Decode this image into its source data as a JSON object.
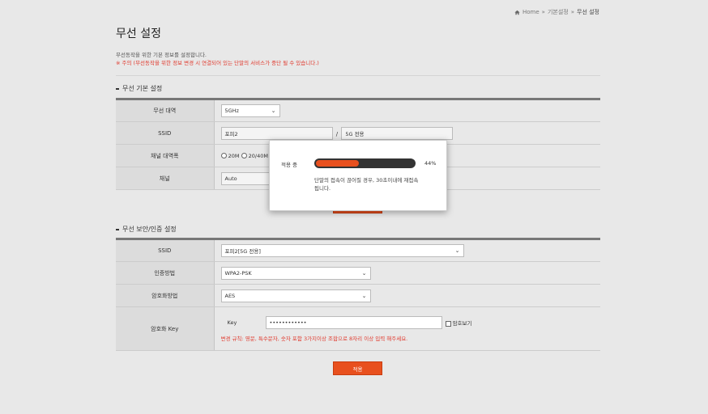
{
  "breadcrumb": {
    "home": "Home",
    "sep1": "»",
    "parent": "기본설정",
    "sep2": "»",
    "current": "무선 설정"
  },
  "page": {
    "title": "무선 설정",
    "description": "무선동작을 위한 기본 정보를 설정합니다.",
    "warning": "※ 주의 (무선동작을 위한 정보 변경 시 연결되어 있는 단말의 서비스가 중단 될 수 있습니다.)"
  },
  "basic": {
    "section_title": "무선 기본 설정",
    "band": {
      "label": "무선 대역",
      "value": "5GHz"
    },
    "ssid": {
      "label": "SSID",
      "value": "포피2",
      "separator": "/",
      "suffix": "5G 전용"
    },
    "bandwidth": {
      "label": "채널 대역폭",
      "option1": "20M",
      "option2": "20/40M"
    },
    "channel": {
      "label": "채널",
      "value": "Auto"
    }
  },
  "security": {
    "section_title": "무선 보안/인증 설정",
    "ssid": {
      "label": "SSID",
      "value": "포피2[5G 전용]"
    },
    "auth": {
      "label": "인증방법",
      "value": "WPA2-PSK"
    },
    "encryption": {
      "label": "암호화방법",
      "value": "AES"
    },
    "key": {
      "label": "암호화 Key",
      "field_label": "Key",
      "value": "••••••••••••",
      "show_label": "암호보기",
      "rule": "변경 규칙: 영문, 특수문자, 숫자 포함 3가지이상 조합으로 8자리 이상 입력 해주세요."
    },
    "apply_label": "적용"
  },
  "modal": {
    "label": "적용 중",
    "progress_percent": 44,
    "percent_text": "44%",
    "message": "단말의 접속이 끊어질 경우, 30초이내에 재접속 됩니다."
  },
  "colors": {
    "accent": "#e8501e",
    "warning": "#e03a2e"
  },
  "icons": {
    "home": "home-icon",
    "dropdown": "chevron-down-icon"
  }
}
